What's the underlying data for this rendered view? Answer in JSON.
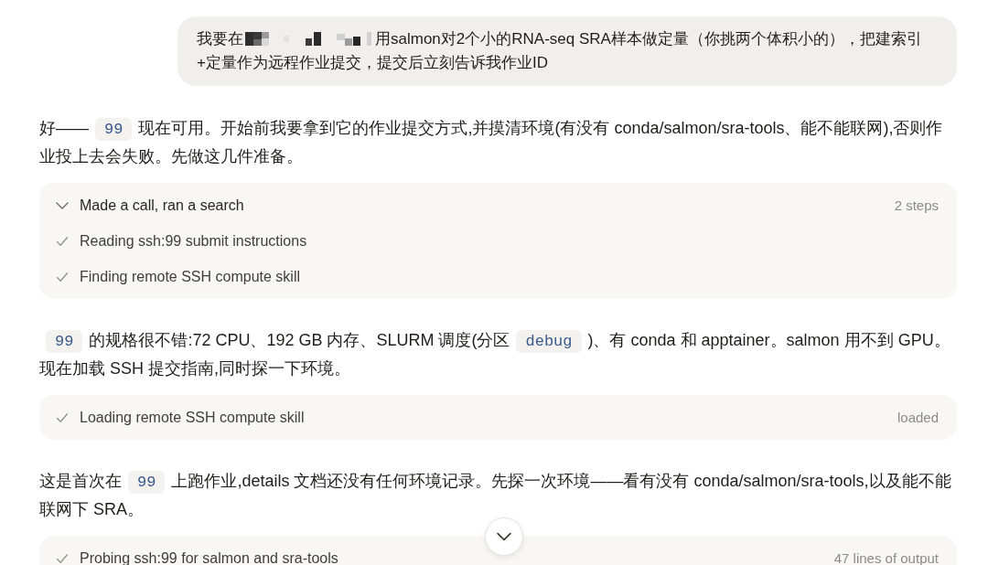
{
  "user_message": {
    "parts": [
      {
        "kind": "text",
        "text": "我要在"
      },
      {
        "kind": "redacted"
      },
      {
        "kind": "text",
        "text": "用salmon对2个小的RNA-seq SRA样本做定量（你挑两个体积小的），把建索引+定量作为远程作业提交，提交后立刻告诉我作业ID"
      }
    ]
  },
  "thread": [
    {
      "kind": "paragraph",
      "segments": [
        {
          "kind": "text",
          "text": "好——"
        },
        {
          "kind": "code",
          "text": "99"
        },
        {
          "kind": "text",
          "text": "现在可用。开始前我要拿到它的作业提交方式,并摸清环境(有没有 conda/salmon/sra-tools、能不能联网),否则作业投上去会失败。先做这几件准备。"
        }
      ]
    },
    {
      "kind": "steps",
      "rows": [
        {
          "kind": "group",
          "label": "Made a call, ran a search",
          "detail": "2 steps",
          "expanded": true
        },
        {
          "kind": "step",
          "label": "Reading ssh:99 submit instructions",
          "done": true
        },
        {
          "kind": "step",
          "label": "Finding remote SSH compute skill",
          "done": true
        }
      ]
    },
    {
      "kind": "paragraph",
      "segments": [
        {
          "kind": "code",
          "text": "99"
        },
        {
          "kind": "text",
          "text": "的规格很不错:72 CPU、192 GB 内存、SLURM 调度(分区"
        },
        {
          "kind": "code",
          "text": "debug"
        },
        {
          "kind": "text",
          "text": ")、有 conda 和 apptainer。salmon 用不到 GPU。现在加载 SSH 提交指南,同时探一下环境。"
        }
      ]
    },
    {
      "kind": "steps",
      "rows": [
        {
          "kind": "step",
          "label": "Loading remote SSH compute skill",
          "detail": "loaded",
          "done": true
        }
      ]
    },
    {
      "kind": "paragraph",
      "segments": [
        {
          "kind": "text",
          "text": "这是首次在"
        },
        {
          "kind": "code",
          "text": "99"
        },
        {
          "kind": "text",
          "text": "上跑作业,details 文档还没有任何环境记录。先探一次环境——看有没有 conda/salmon/sra-tools,以及能不能联网下 SRA。"
        }
      ]
    },
    {
      "kind": "steps",
      "rows": [
        {
          "kind": "step",
          "label": "Probing ssh:99 for salmon and sra-tools",
          "detail": "47 lines of output",
          "done": true
        }
      ]
    }
  ]
}
